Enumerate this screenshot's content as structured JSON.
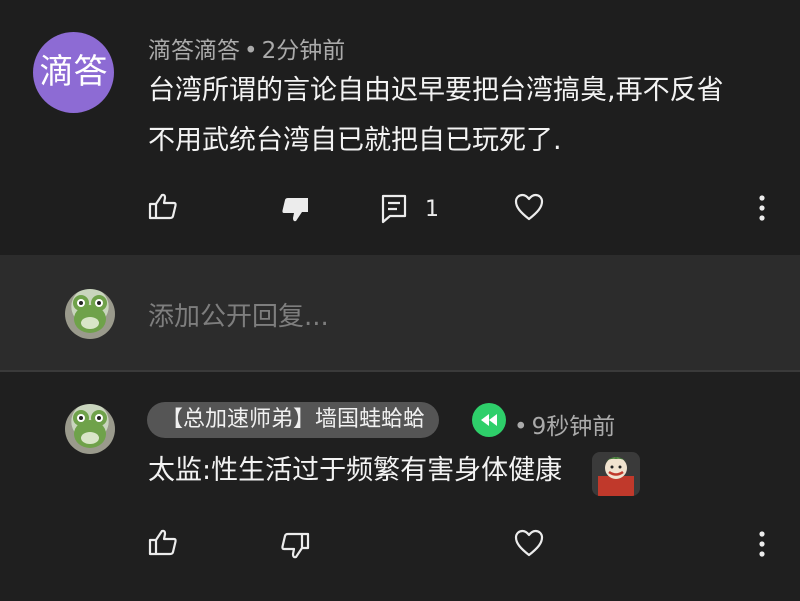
{
  "comment1": {
    "avatar_text": "滴答",
    "author": "滴答滴答",
    "separator": "•",
    "time": "2分钟前",
    "line1": "台湾所谓的言论自由迟早要把台湾搞臭,再不反省",
    "line2": "不用武统台湾自已就把自已玩死了.",
    "reply_count": "1",
    "avatar_color": "#8d6bd4"
  },
  "reply_box": {
    "placeholder": "添加公开回复..."
  },
  "comment2": {
    "tag": "【总加速师弟】墙国蛙蛤蛤",
    "separator": "•",
    "time": "9秒钟前",
    "text": "太监:性生活过于频繁有害身体健康",
    "badge_color": "#2ecf6a"
  }
}
